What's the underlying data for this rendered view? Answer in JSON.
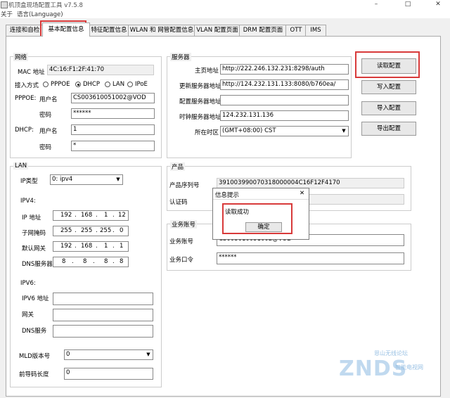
{
  "window": {
    "title": "机顶盒现场配置工具 v7.5.8",
    "minimize": "–",
    "maximize": "□",
    "close": "✕"
  },
  "menu": {
    "about": "关于",
    "language": "语言(Language)"
  },
  "tabs": [
    "连接和自检",
    "基本配置信息",
    "特征配置信息",
    "WLAN 和 网管配置信息",
    "VLAN 配置页面",
    "DRM 配置页面",
    "OTT",
    "IMS"
  ],
  "active_tab": "基本配置信息",
  "network": {
    "title": "网络",
    "mac_label": "MAC 地址",
    "mac_value": "4C:16:F1:2F:41:70",
    "access_label": "接入方式",
    "options": [
      "PPPOE",
      "DHCP",
      "LAN",
      "IPoE"
    ],
    "selected": "DHCP",
    "pppoe_label": "PPPOE:",
    "pppoe_user_label": "用户名",
    "pppoe_user": "CS003610051002@VOD",
    "pppoe_pwd_label": "密码",
    "pppoe_pwd": "******",
    "dhcp_label": "DHCP:",
    "dhcp_user_label": "用户名",
    "dhcp_user": "1",
    "dhcp_pwd_label": "密码",
    "dhcp_pwd": "*"
  },
  "server": {
    "title": "服务器",
    "home_label": "主页地址",
    "home": "http://222.246.132.231:8298/auth",
    "update_label": "更新服务器地址",
    "update": "http://124.232.131.133:8080/b760ea/",
    "config_label": "配置服务器地址",
    "config": "",
    "ntp_label": "时钟服务器地址",
    "ntp": "124.232.131.136",
    "tz_label": "所在时区",
    "tz": "(GMT+08:00) CST"
  },
  "actions": {
    "read": "读取配置",
    "write": "写入配置",
    "import": "导入配置",
    "export": "导出配置"
  },
  "lan": {
    "title": "LAN",
    "iptype_label": "IP类型",
    "iptype": "0: ipv4",
    "ipv4_label": "IPV4:",
    "ip_label": "IP 地址",
    "ip": [
      "192",
      "168",
      "1",
      "12"
    ],
    "mask_label": "子网掩码",
    "mask": [
      "255",
      "255",
      "255",
      "0"
    ],
    "gw_label": "默认网关",
    "gw": [
      "192",
      "168",
      "1",
      "1"
    ],
    "dns_label": "DNS服务器",
    "dns": [
      "8",
      "8",
      "8",
      "8"
    ],
    "ipv6_label": "IPV6:",
    "ipv6_addr_label": "IPV6 地址",
    "ipv6_gw_label": "网关",
    "ipv6_dns_label": "DNS服务",
    "mld_label": "MLD版本号",
    "mld": "0",
    "prefix_label": "前导码长度",
    "prefix": "0"
  },
  "product": {
    "title": "产品",
    "serial_label": "产品序列号",
    "serial": "391003990070318000004C16F12F4170",
    "auth_label": "认证码"
  },
  "account": {
    "title": "业务账号",
    "acc_label": "业务账号",
    "acc": "CS003610051002@VOD",
    "pwd_label": "业务口令",
    "pwd": "******"
  },
  "dialog": {
    "title": "信息提示",
    "close": "✕",
    "message": "读取成功",
    "ok": "确定"
  },
  "watermark": {
    "line1": "恩山无线论坛",
    "line2": "ZNDS",
    "line3": "智能电视网"
  },
  "colors": {
    "highlight": "#d83a3a",
    "panel": "#f0f0f0"
  }
}
